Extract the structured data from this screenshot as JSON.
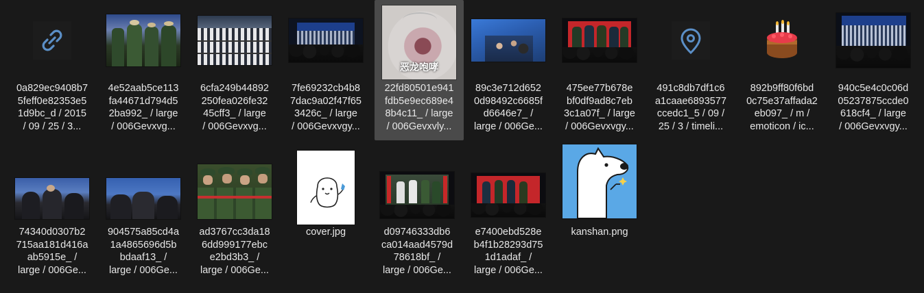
{
  "colors": {
    "background": "#191919",
    "selection": "#4a4a4a",
    "icon_blue": "#5b8fc7",
    "text": "#e8e8e8"
  },
  "thumbnail_texts": {
    "dragon_caption": "恶龙咆哮"
  },
  "files": [
    {
      "kind": "link-icon",
      "name_lines": [
        "0a829ec9408b7",
        "5feff0e82353e5",
        "1d9bc_d / 2015",
        "/ 09 / 25 / 3..."
      ]
    },
    {
      "kind": "photo",
      "name_lines": [
        "4e52aab5ce113",
        "fa44671d794d5",
        "2ba992_ / large",
        "/ 006Gevxvg..."
      ]
    },
    {
      "kind": "photo",
      "name_lines": [
        "6cfa249b44892",
        "250fea026fe32",
        "45cff3_ / large",
        "/ 006Gevxvg..."
      ]
    },
    {
      "kind": "photo",
      "name_lines": [
        "7fe69232cb4b8",
        "7dac9a02f47f65",
        "3426c_ / large",
        "/ 006Gevxvgy..."
      ]
    },
    {
      "kind": "photo",
      "name_lines": [
        "22fd80501e941",
        "fdb5e9ec689e4",
        "8b4c11_ / large",
        "/ 006Gevxvly..."
      ],
      "selected": true
    },
    {
      "kind": "photo",
      "name_lines": [
        "89c3e712d652",
        "0d98492c6685f",
        "d6646e7_ /",
        "large / 006Ge..."
      ]
    },
    {
      "kind": "photo",
      "name_lines": [
        "475ee77b678e",
        "bf0df9ad8c7eb",
        "3c1a07f_ / large",
        "/ 006Gevxvgy..."
      ]
    },
    {
      "kind": "location-icon",
      "name_lines": [
        "491c8db7df1c6",
        "a1caae6893577",
        "ccedc1_5 / 09 /",
        "25 / 3 / timeli..."
      ]
    },
    {
      "kind": "cake-icon",
      "name_lines": [
        "892b9ff80f6bd",
        "0c75e37affada2",
        "eb097_ / m /",
        "emoticon / ic..."
      ]
    },
    {
      "kind": "photo",
      "name_lines": [
        "940c5e4c0c06d",
        "05237875ccde0",
        "618cf4_ / large",
        "/ 006Gevxvgy..."
      ]
    },
    {
      "kind": "photo",
      "name_lines": [
        "74340d0307b2",
        "715aa181d416a",
        "ab5915e_ /",
        "large / 006Ge..."
      ]
    },
    {
      "kind": "photo",
      "name_lines": [
        "904575a85cd4a",
        "1a4865696d5b",
        "bdaaf13_ /",
        "large / 006Ge..."
      ]
    },
    {
      "kind": "photo",
      "name_lines": [
        "ad3767cc3da18",
        "6dd999177ebc",
        "e2bd3b3_ /",
        "large / 006Ge..."
      ]
    },
    {
      "kind": "cover-image",
      "name_lines": [
        "cover.jpg"
      ]
    },
    {
      "kind": "photo",
      "name_lines": [
        "d09746333db6",
        "ca014aad4579d",
        "78618bf_ /",
        "large / 006Ge..."
      ]
    },
    {
      "kind": "photo",
      "name_lines": [
        "e7400ebd528e",
        "b4f1b28293d75",
        "1d1adaf_ /",
        "large / 006Ge..."
      ]
    },
    {
      "kind": "cartoon-image",
      "name_lines": [
        "kanshan.png"
      ]
    }
  ]
}
